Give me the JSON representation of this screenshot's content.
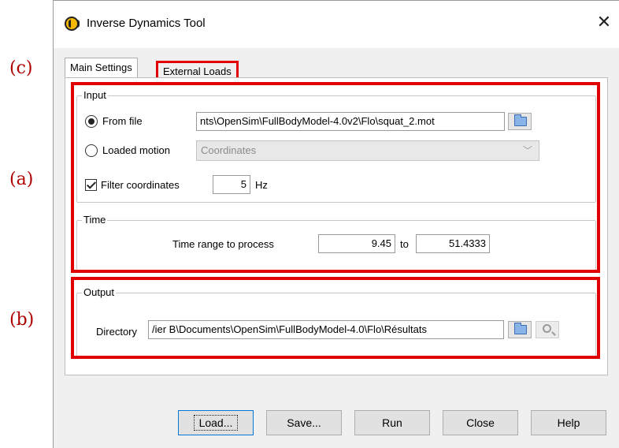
{
  "annotations": {
    "c": "(c)",
    "a": "(a)",
    "b": "(b)"
  },
  "window": {
    "title": "Inverse Dynamics Tool",
    "close_glyph": "✕",
    "app_icon": "opensim-icon"
  },
  "tabs": [
    {
      "label": "Main Settings",
      "selected": true
    },
    {
      "label": "External Loads",
      "selected": false
    }
  ],
  "input": {
    "title": "Input",
    "from_file_label": "From file",
    "from_file_selected": true,
    "file_path": "nts\\OpenSim\\FullBodyModel-4.0v2\\Flo\\squat_2.mot",
    "loaded_motion_label": "Loaded motion",
    "loaded_motion_value": "Coordinates",
    "filter_label": "Filter coordinates",
    "filter_checked": true,
    "filter_value": "5",
    "filter_unit": "Hz"
  },
  "time": {
    "title": "Time",
    "range_label": "Time range to process",
    "start": "9.45",
    "to_label": "to",
    "end": "51.4333"
  },
  "output": {
    "title": "Output",
    "directory_label": "Directory",
    "directory_value": "/ier B\\Documents\\OpenSim\\FullBodyModel-4.0\\Flo\\Résultats"
  },
  "buttons": {
    "load": "Load...",
    "save": "Save...",
    "run": "Run",
    "close": "Close",
    "help": "Help"
  },
  "colors": {
    "highlight_red": "#e00000",
    "window_bg": "#f0f0f0"
  }
}
